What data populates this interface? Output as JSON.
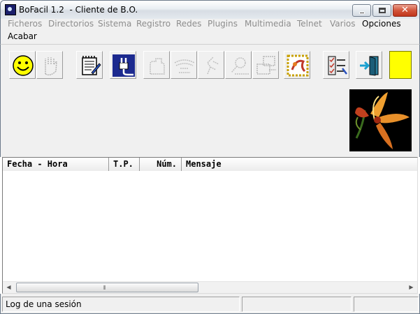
{
  "window": {
    "title": "BoFacil 1.2  - Cliente de B.O.",
    "min_glyph": "",
    "max_glyph": "",
    "close_glyph": "✕"
  },
  "menu": {
    "items": [
      {
        "label": "Ficheros",
        "enabled": false
      },
      {
        "label": "Directorios",
        "enabled": false
      },
      {
        "label": "Sistema",
        "enabled": false
      },
      {
        "label": "Registro",
        "enabled": false
      },
      {
        "label": "Redes",
        "enabled": false
      },
      {
        "label": "Plugins",
        "enabled": false
      },
      {
        "label": "Multimedia",
        "enabled": false
      },
      {
        "label": "Telnet",
        "enabled": false
      },
      {
        "label": "Varios",
        "enabled": false
      },
      {
        "label": "Opciones",
        "enabled": true
      },
      {
        "label": "Acabar",
        "enabled": true
      }
    ]
  },
  "toolbar": {
    "buttons": [
      {
        "icon": "smiley-icon",
        "enabled": true
      },
      {
        "icon": "hand-icon",
        "enabled": false
      },
      {
        "icon": "notepad-icon",
        "enabled": true
      },
      {
        "icon": "plug-connect-icon",
        "enabled": true
      },
      {
        "icon": "folder-icon",
        "enabled": false
      },
      {
        "icon": "network-icon",
        "enabled": false
      },
      {
        "icon": "process-icon",
        "enabled": false
      },
      {
        "icon": "search-icon",
        "enabled": false
      },
      {
        "icon": "computer-icon",
        "enabled": false
      },
      {
        "icon": "stamp-icon",
        "enabled": true
      },
      {
        "icon": "checklist-icon",
        "enabled": true
      },
      {
        "icon": "exit-door-icon",
        "enabled": true
      }
    ],
    "color_swatch": "#ffff00"
  },
  "log_table": {
    "columns": [
      "Fecha - Hora",
      "T.P.",
      "Núm.",
      "Mensaje"
    ],
    "rows": []
  },
  "scrollbar": {
    "grip": "⦀"
  },
  "statusbar": {
    "panels": [
      "Log de una sesión",
      "",
      ""
    ]
  }
}
